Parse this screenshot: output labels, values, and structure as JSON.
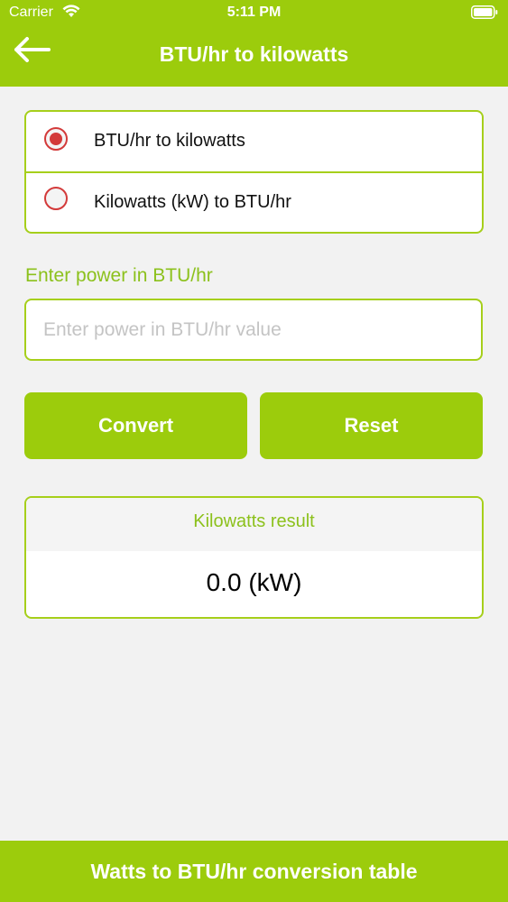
{
  "status_bar": {
    "carrier": "Carrier",
    "time": "5:11 PM",
    "wifi_icon": "wifi-icon",
    "battery_icon": "battery-icon"
  },
  "nav": {
    "title": "BTU/hr to kilowatts",
    "back_icon": "arrow-left-icon"
  },
  "conversion_options": [
    {
      "label": "BTU/hr to kilowatts",
      "selected": true
    },
    {
      "label": "Kilowatts (kW) to BTU/hr",
      "selected": false
    }
  ],
  "input": {
    "label": "Enter power in BTU/hr",
    "placeholder": "Enter power in BTU/hr value",
    "value": ""
  },
  "buttons": {
    "convert": "Convert",
    "reset": "Reset"
  },
  "result": {
    "title": "Kilowatts result",
    "value": "0.0 (kW)"
  },
  "footer": {
    "label": "Watts to BTU/hr conversion table"
  },
  "colors": {
    "accent": "#9ccc0c",
    "radio": "#d33a3a",
    "background": "#f2f2f2"
  }
}
